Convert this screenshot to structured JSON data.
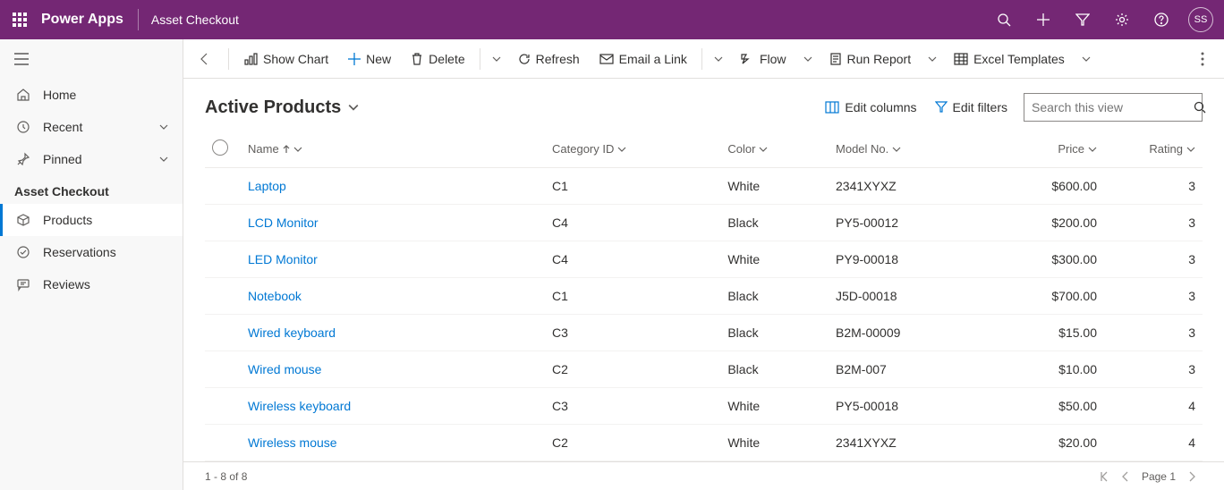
{
  "header": {
    "brand": "Power Apps",
    "app_name": "Asset Checkout",
    "avatar_initials": "SS"
  },
  "sidebar": {
    "home": "Home",
    "recent": "Recent",
    "pinned": "Pinned",
    "section": "Asset Checkout",
    "items": [
      {
        "label": "Products"
      },
      {
        "label": "Reservations"
      },
      {
        "label": "Reviews"
      }
    ]
  },
  "commands": {
    "show_chart": "Show Chart",
    "new": "New",
    "delete": "Delete",
    "refresh": "Refresh",
    "email_link": "Email a Link",
    "flow": "Flow",
    "run_report": "Run Report",
    "excel_templates": "Excel Templates"
  },
  "view": {
    "title": "Active Products",
    "edit_columns": "Edit columns",
    "edit_filters": "Edit filters",
    "search_placeholder": "Search this view"
  },
  "columns": {
    "name": "Name",
    "category_id": "Category ID",
    "color": "Color",
    "model_no": "Model No.",
    "price": "Price",
    "rating": "Rating"
  },
  "rows": [
    {
      "name": "Laptop",
      "category_id": "C1",
      "color": "White",
      "model_no": "2341XYXZ",
      "price": "$600.00",
      "rating": "3"
    },
    {
      "name": "LCD Monitor",
      "category_id": "C4",
      "color": "Black",
      "model_no": "PY5-00012",
      "price": "$200.00",
      "rating": "3"
    },
    {
      "name": "LED Monitor",
      "category_id": "C4",
      "color": "White",
      "model_no": "PY9-00018",
      "price": "$300.00",
      "rating": "3"
    },
    {
      "name": "Notebook",
      "category_id": "C1",
      "color": "Black",
      "model_no": "J5D-00018",
      "price": "$700.00",
      "rating": "3"
    },
    {
      "name": "Wired keyboard",
      "category_id": "C3",
      "color": "Black",
      "model_no": "B2M-00009",
      "price": "$15.00",
      "rating": "3"
    },
    {
      "name": "Wired mouse",
      "category_id": "C2",
      "color": "Black",
      "model_no": "B2M-007",
      "price": "$10.00",
      "rating": "3"
    },
    {
      "name": "Wireless keyboard",
      "category_id": "C3",
      "color": "White",
      "model_no": "PY5-00018",
      "price": "$50.00",
      "rating": "4"
    },
    {
      "name": "Wireless mouse",
      "category_id": "C2",
      "color": "White",
      "model_no": "2341XYXZ",
      "price": "$20.00",
      "rating": "4"
    }
  ],
  "footer": {
    "range": "1 - 8 of 8",
    "page": "Page 1"
  }
}
